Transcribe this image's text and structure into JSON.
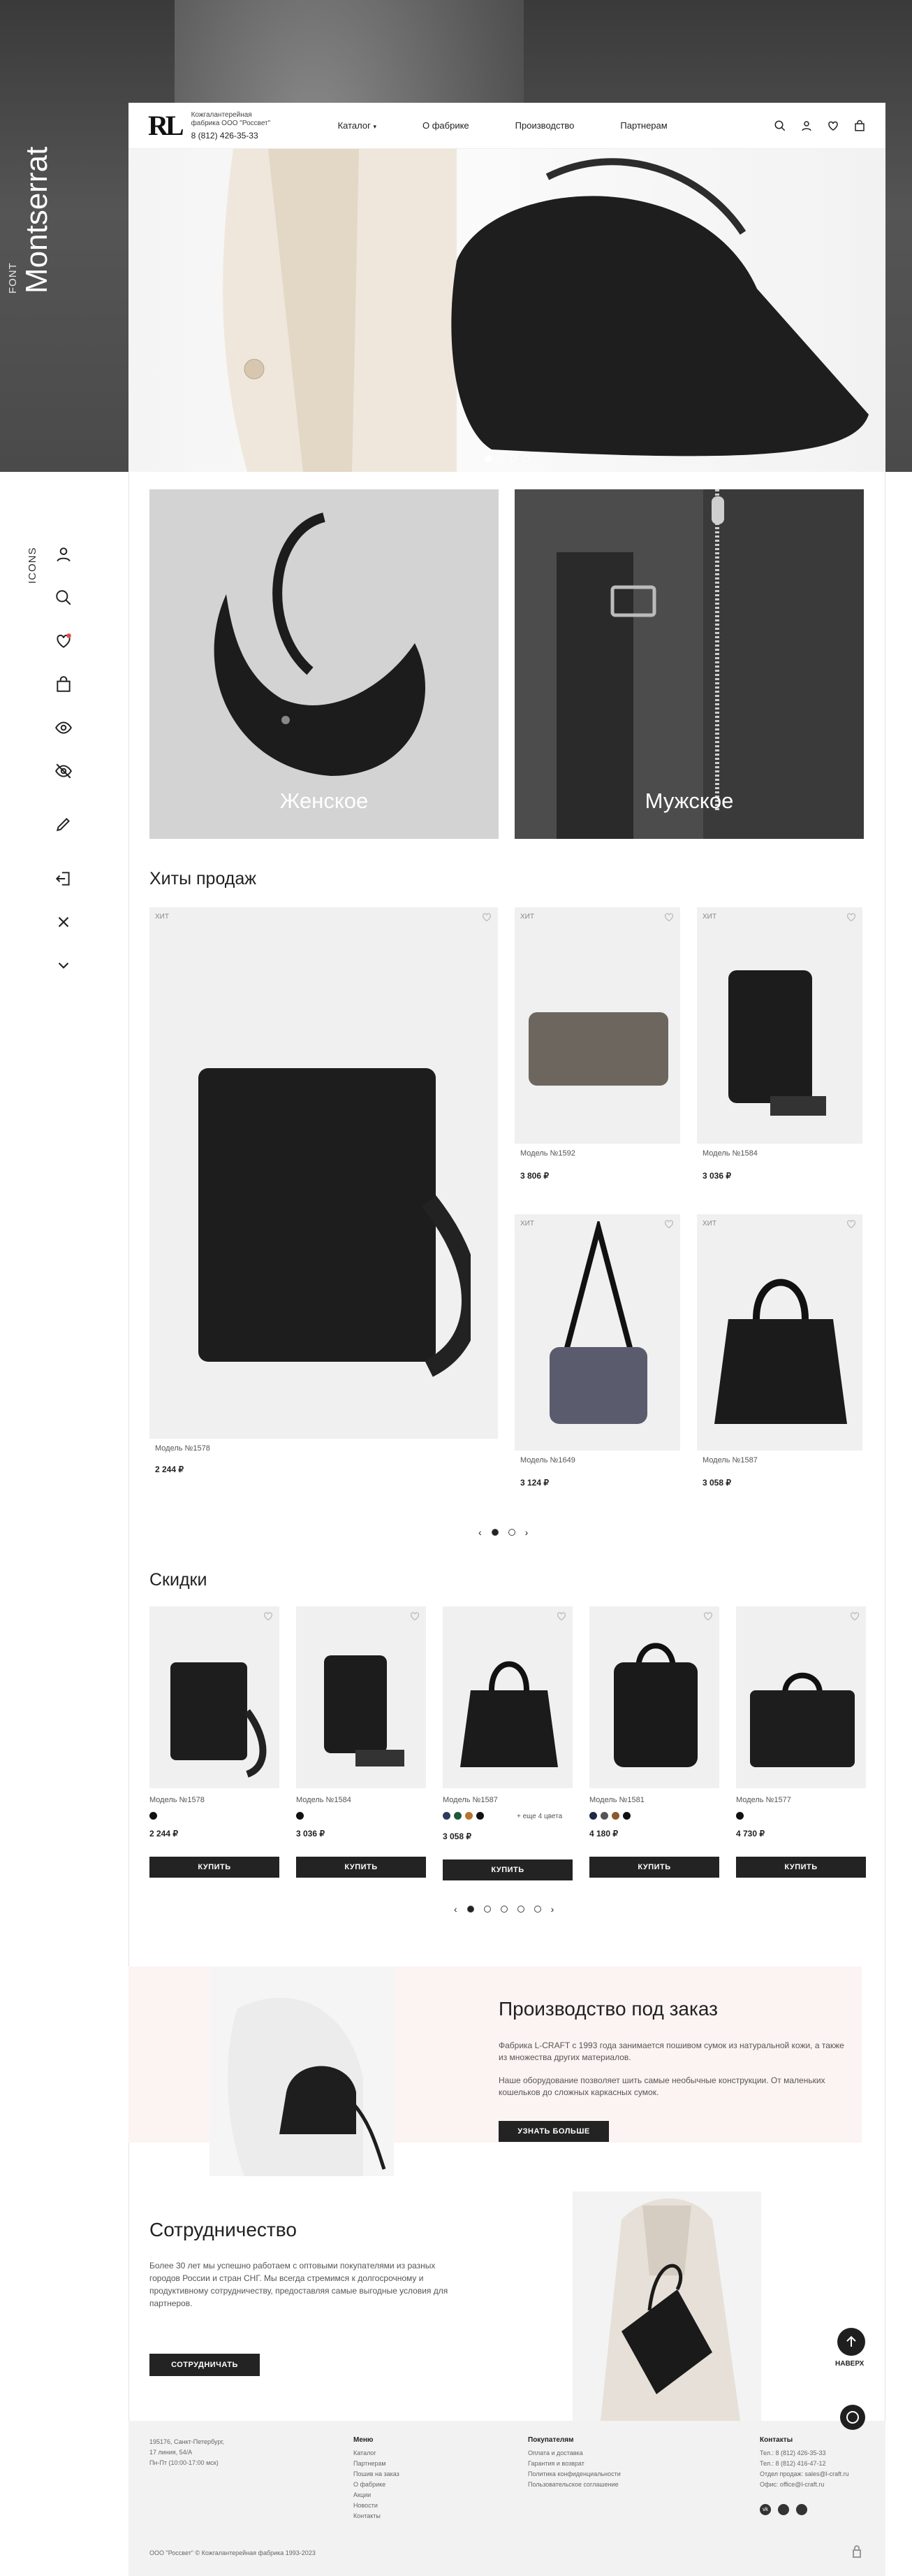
{
  "font_panel": {
    "label": "FONT",
    "name": "Montserrat"
  },
  "icons_panel": {
    "label": "ICONS",
    "icons": [
      "user-icon",
      "search-icon",
      "heart-icon",
      "bag-icon",
      "eye-icon",
      "eye-off-icon",
      "pencil-icon",
      "logout-icon",
      "close-icon",
      "chevron-down-icon"
    ]
  },
  "header": {
    "logo": "RL",
    "brand_line1": "Кожгалантерейная",
    "brand_line2": "фабрика ООО \"Россвет\"",
    "phone": "8 (812) 426-35-33",
    "nav": [
      "Каталог",
      "О фабрике",
      "Производство",
      "Партнерам"
    ]
  },
  "categories": [
    {
      "label": "Женское"
    },
    {
      "label": "Мужское"
    }
  ],
  "hits": {
    "title": "Хиты продаж",
    "badge": "ХИТ",
    "items": [
      {
        "model": "Модель №1578",
        "price": "2 244 ₽"
      },
      {
        "model": "Модель №1592",
        "price": "3 806 ₽"
      },
      {
        "model": "Модель №1584",
        "price": "3 036 ₽"
      },
      {
        "model": "Модель №1649",
        "price": "3 124 ₽"
      },
      {
        "model": "Модель №1587",
        "price": "3 058 ₽"
      }
    ]
  },
  "discounts": {
    "title": "Скидки",
    "buy_label": "КУПИТЬ",
    "items": [
      {
        "model": "Модель №1578",
        "price": "2 244 ₽"
      },
      {
        "model": "Модель №1584",
        "price": "3 036 ₽"
      },
      {
        "model": "Модель №1587",
        "price": "3 058 ₽",
        "more": "+ еще 4 цвета"
      },
      {
        "model": "Модель №1581",
        "price": "4 180 ₽"
      },
      {
        "model": "Модель №1577",
        "price": "4 730 ₽"
      }
    ]
  },
  "production": {
    "title": "Производство под заказ",
    "p1": "Фабрика L-CRAFT с 1993 года занимается пошивом сумок из натуральной кожи, а также из множества других материалов.",
    "p2": "Наше оборудование позволяет шить самые необычные конструкции. От маленьких кошельков до сложных каркасных сумок.",
    "button": "УЗНАТЬ БОЛЬШЕ"
  },
  "cooperation": {
    "title": "Сотрудничество",
    "text": "Более 30 лет мы успешно работаем с оптовыми покупателями из разных городов России и стран СНГ. Мы всегда стремимся к долгосрочному и продуктивному сотрудничеству, предоставляя самые выгодные условия для партнеров.",
    "button": "СОТРУДНИЧАТЬ",
    "up_label": "НАВЕРХ"
  },
  "footer": {
    "address": [
      "195176, Санкт-Петербург,",
      "17 линия, 54/А",
      "Пн-Пт (10:00-17:00 мск)"
    ],
    "menu_title": "Меню",
    "menu": [
      "Каталог",
      "Партнерам",
      "Пошив на заказ",
      "О фабрике",
      "Акции",
      "Новости",
      "Контакты"
    ],
    "buyers_title": "Покупателям",
    "buyers": [
      "Оплата и доставка",
      "Гарантия и возврат",
      "Политика конфиденциальности",
      "Пользовательское соглашение"
    ],
    "contacts_title": "Контакты",
    "contacts": [
      "Тел.: 8 (812) 426-35-33",
      "Тел.: 8 (812) 416-47-12",
      "Отдел продаж: sales@l-craft.ru",
      "Офис: office@l-craft.ru"
    ],
    "copyright": "ООО \"Россвет\" © Кожгалантерейная фабрика 1993-2023"
  },
  "colors": {
    "dark": "#232323",
    "pink": "#fcf4f2",
    "grey": "#f0f0f0"
  }
}
